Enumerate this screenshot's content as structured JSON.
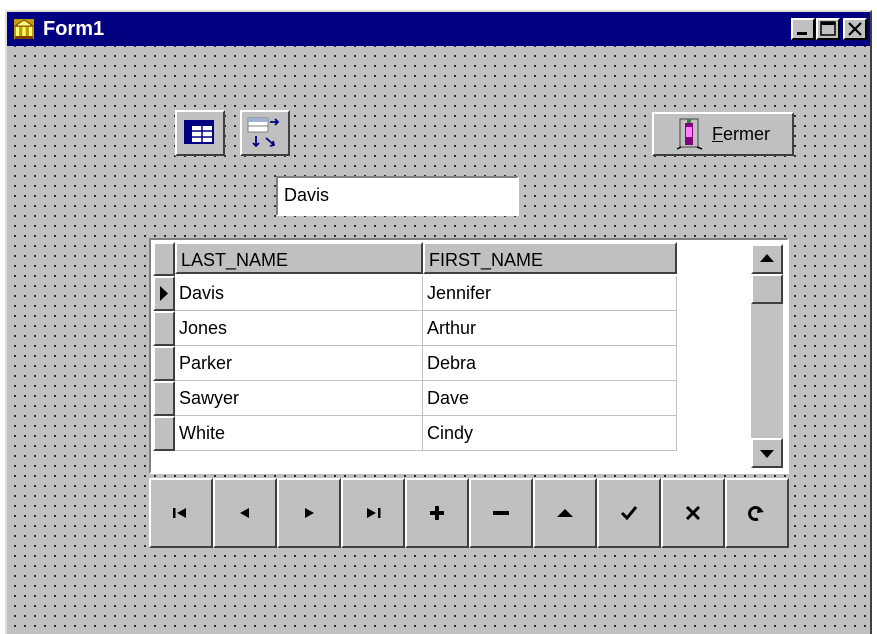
{
  "window": {
    "title": "Form1"
  },
  "title_buttons": {
    "minimize": "_",
    "maximize": "□",
    "close": "✕"
  },
  "toolbar": {
    "grid_icon": "grid-view-icon",
    "sort_icon": "sort-fields-icon"
  },
  "close_button": {
    "label_prefix": "",
    "label_accel": "F",
    "label_rest": "ermer",
    "icon": "door-exit-icon"
  },
  "edit_field": {
    "value": "Davis"
  },
  "grid": {
    "columns": [
      "LAST_NAME",
      "FIRST_NAME"
    ],
    "rows": [
      {
        "last": "Davis",
        "first": "Jennifer",
        "current": true
      },
      {
        "last": "Jones",
        "first": "Arthur",
        "current": false
      },
      {
        "last": "Parker",
        "first": "Debra",
        "current": false
      },
      {
        "last": "Sawyer",
        "first": "Dave",
        "current": false
      },
      {
        "last": "White",
        "first": "Cindy",
        "current": false
      }
    ]
  },
  "navigator": {
    "buttons": [
      {
        "name": "first",
        "glyph": "I◀"
      },
      {
        "name": "prior",
        "glyph": "◀"
      },
      {
        "name": "next",
        "glyph": "▶"
      },
      {
        "name": "last",
        "glyph": "▶I"
      },
      {
        "name": "insert",
        "glyph": "+"
      },
      {
        "name": "delete",
        "glyph": "−"
      },
      {
        "name": "edit",
        "glyph": "▲"
      },
      {
        "name": "post",
        "glyph": "✓"
      },
      {
        "name": "cancel",
        "glyph": "✕"
      },
      {
        "name": "refresh",
        "glyph": "↻"
      }
    ]
  },
  "colors": {
    "titlebar": "#000080",
    "face": "#c0c0c0"
  }
}
